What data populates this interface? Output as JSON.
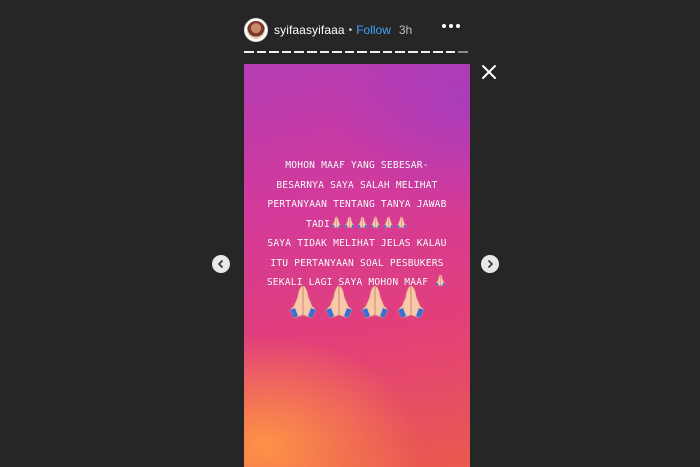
{
  "header": {
    "username": "syifaasyifaaa",
    "separator": "•",
    "follow_label": "Follow",
    "time": "3h"
  },
  "icons": {
    "more": "more-options-icon",
    "close": "close-icon",
    "prev": "chevron-left-icon",
    "next": "chevron-right-icon",
    "emoji": "praying-hands-emoji"
  },
  "progress": {
    "segments": 18,
    "current_segment": 18
  },
  "story": {
    "lines": [
      "MOHON MAAF YANG SEBESAR-",
      "BESARNYA SAYA SALAH MELIHAT",
      "PERTANYAAN TENTANG TANYA JAWAB",
      "TADI",
      "SAYA TIDAK MELIHAT JELAS KALAU",
      "ITU PERTANYAAN SOAL PESBUKERS",
      "SEKALI LAGI SAYA MOHON MAAF"
    ],
    "tadi_emoji_count": 6,
    "big_emoji_count": 4
  },
  "colors": {
    "background": "#262626",
    "follow": "#3fa2f7",
    "story_top": "#b43cb4",
    "story_bottom": "#ea5a4e"
  }
}
